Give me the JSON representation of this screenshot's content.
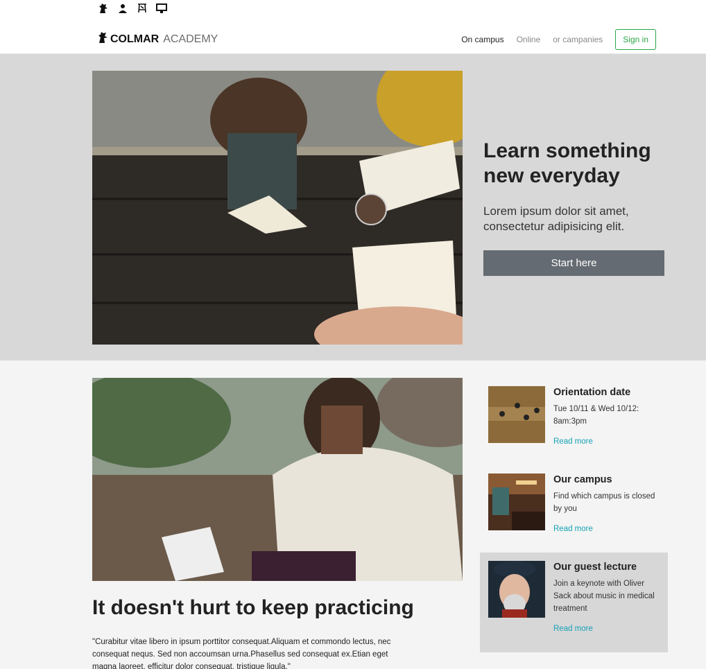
{
  "icons": [
    "dragon-icon",
    "person-icon",
    "easel-icon",
    "monitor-icon"
  ],
  "brand": {
    "bold": "COLMAR",
    "light": "ACADEMY"
  },
  "nav": {
    "items": [
      "On campus",
      "Online",
      "or campanies"
    ],
    "signin": "Sign in"
  },
  "hero": {
    "title": "Learn something new everyday",
    "subtitle": "Lorem ipsum dolor sit amet, consectetur adipisicing elit.",
    "button": "Start here"
  },
  "feature": {
    "title": "It doesn't hurt to keep practicing",
    "text": "\"Curabitur vitae libero in ipsum porttitor consequat.Aliquam et commondo lectus, nec consequat nequs. Sed non accoumsan urna.Phasellus sed consequat ex.Etian eget magna laoreet, efficitur dolor consequat, tristique ligula.\""
  },
  "cards": [
    {
      "title": "Orientation date",
      "text": "Tue 10/11 & Wed 10/12: 8am:3pm",
      "link": "Read more"
    },
    {
      "title": "Our campus",
      "text": "Find which campus is closed by you",
      "link": "Read more"
    },
    {
      "title": "Our guest lecture",
      "text": "Join a keynote with Oliver Sack about music in medical treatment",
      "link": "Read more"
    }
  ],
  "colors": {
    "accent": "#28a745",
    "link": "#17a2b8",
    "button": "#646b72",
    "hero_bg": "#d8d8d8"
  }
}
